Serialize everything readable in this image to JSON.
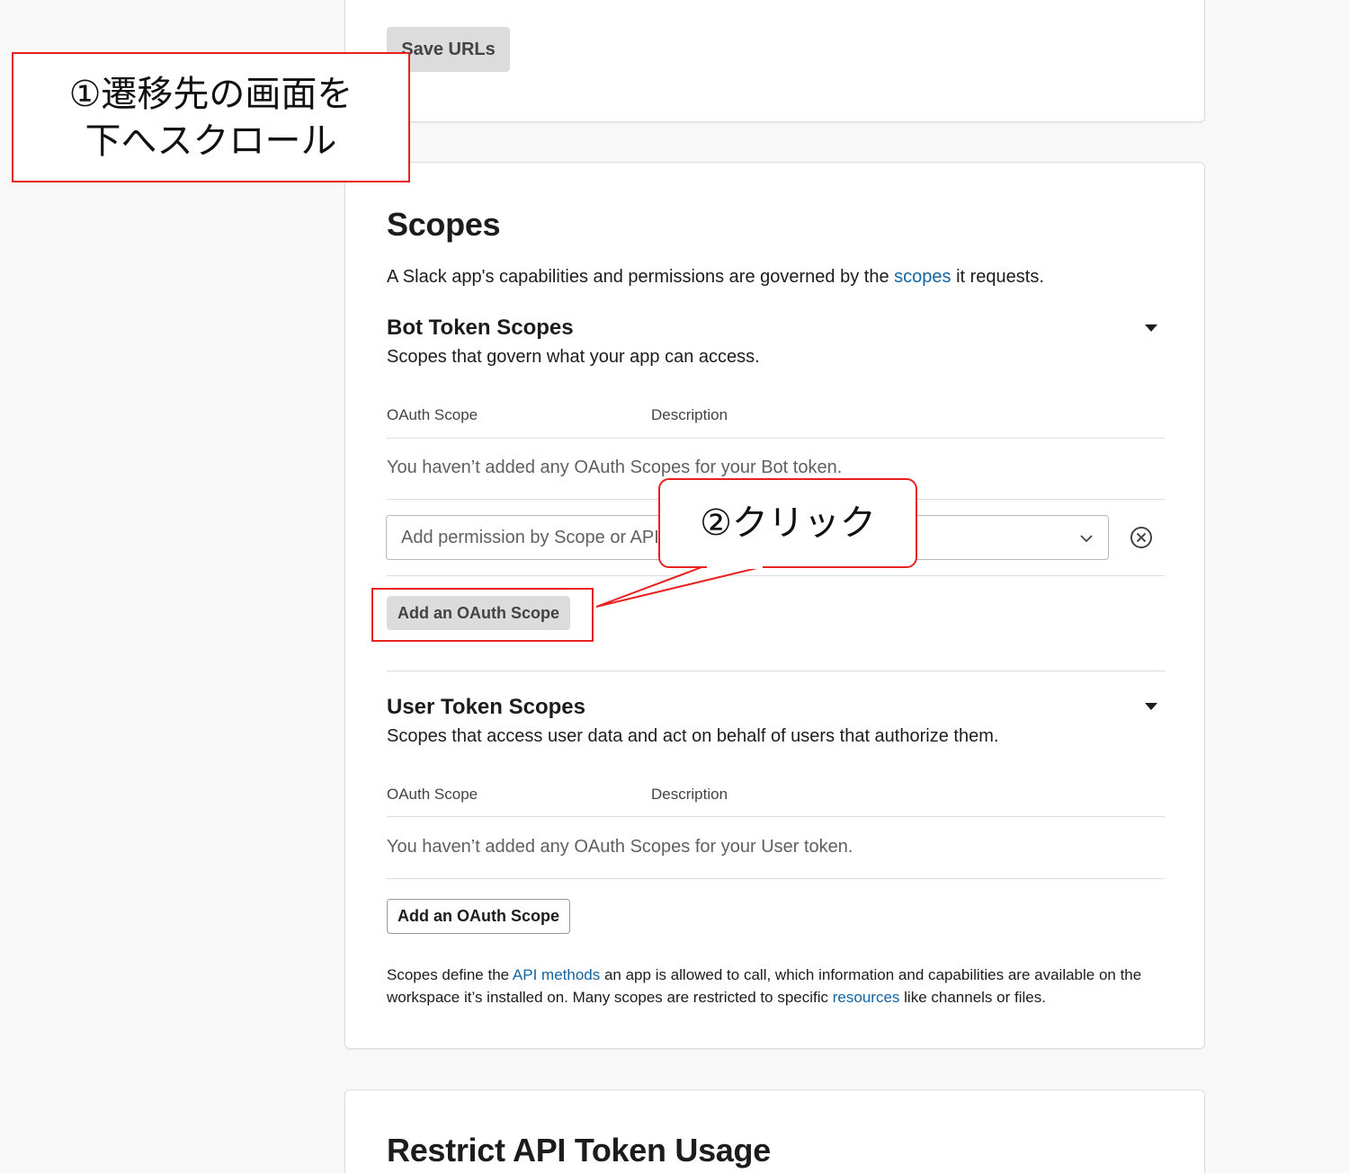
{
  "top_card": {
    "save_urls_label": "Save URLs"
  },
  "scopes": {
    "title": "Scopes",
    "intro_prefix": "A Slack app's capabilities and permissions are governed by the",
    "intro_link": "scopes",
    "intro_suffix": "it requests.",
    "bot": {
      "title": "Bot Token Scopes",
      "subtitle": "Scopes that govern what your app can access.",
      "col_scope": "OAuth Scope",
      "col_description": "Description",
      "empty": "You haven’t added any OAuth Scopes for your Bot token.",
      "select_placeholder": "Add permission by Scope or API method...",
      "add_label": "Add an OAuth Scope"
    },
    "user": {
      "title": "User Token Scopes",
      "subtitle": "Scopes that access user data and act on behalf of users that authorize them.",
      "col_scope": "OAuth Scope",
      "col_description": "Description",
      "empty": "You haven’t added any OAuth Scopes for your User token.",
      "add_label": "Add an OAuth Scope"
    },
    "footer": {
      "part1": "Scopes define the",
      "link1": "API methods",
      "part2": "an app is allowed to call, which information and capabilities are available on the workspace it’s installed on. Many scopes are restricted to specific",
      "link2": "resources",
      "part3": "like channels or files."
    }
  },
  "restrict": {
    "title": "Restrict API Token Usage"
  },
  "annotations": {
    "step1_line1": "①遷移先の画面を",
    "step1_line2": "下へスクロール",
    "step2": "②クリック"
  },
  "colors": {
    "accent_red": "#e8201f",
    "link_blue": "#1264a3"
  }
}
